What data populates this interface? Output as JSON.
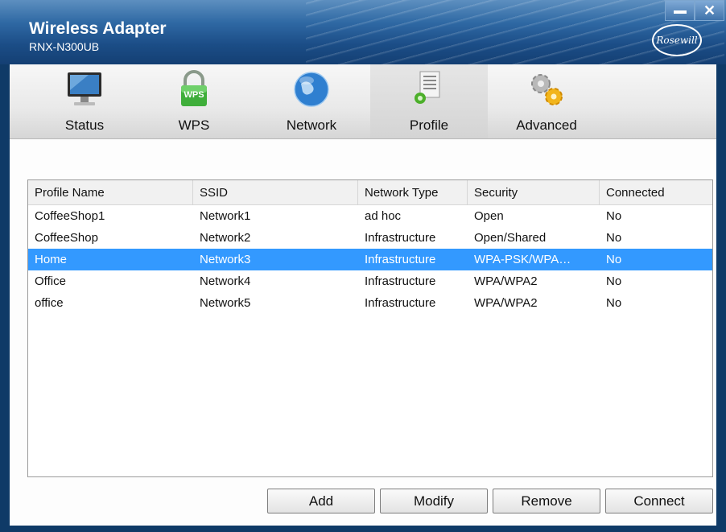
{
  "window": {
    "title": "Wireless Adapter",
    "model": "RNX-N300UB",
    "logo_text": "Rosewill",
    "minimize_label": "",
    "close_label": "✕"
  },
  "tabs": [
    {
      "label": "Status",
      "icon": "monitor-icon",
      "active": false
    },
    {
      "label": "WPS",
      "icon": "wps-lock-icon",
      "badge": "WPS",
      "active": false
    },
    {
      "label": "Network",
      "icon": "globe-icon",
      "active": false
    },
    {
      "label": "Profile",
      "icon": "document-gear-icon",
      "active": true
    },
    {
      "label": "Advanced",
      "icon": "gears-icon",
      "active": false
    }
  ],
  "profile_table": {
    "columns": [
      "Profile Name",
      "SSID",
      "Network Type",
      "Security",
      "Connected"
    ],
    "rows": [
      [
        "CoffeeShop1",
        "Network1",
        "ad hoc",
        "Open",
        "No"
      ],
      [
        "CoffeeShop",
        "Network2",
        "Infrastructure",
        "Open/Shared",
        "No"
      ],
      [
        "Home",
        "Network3",
        "Infrastructure",
        "WPA-PSK/WPA…",
        "No"
      ],
      [
        "Office",
        "Network4",
        "Infrastructure",
        "WPA/WPA2",
        "No"
      ],
      [
        "office",
        "Network5",
        "Infrastructure",
        "WPA/WPA2",
        "No"
      ]
    ],
    "selected_row": 2
  },
  "buttons": {
    "add": "Add",
    "modify": "Modify",
    "remove": "Remove",
    "connect": "Connect"
  },
  "colors": {
    "selection": "#3399ff",
    "title_bar": "#1b4d86"
  }
}
